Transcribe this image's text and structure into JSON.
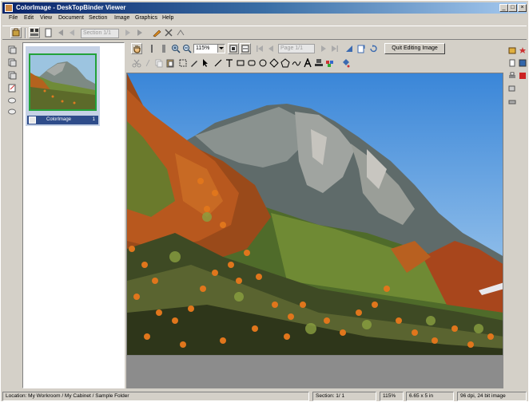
{
  "window": {
    "title": "ColorImage - DeskTopBinder Viewer",
    "buttons": {
      "minimize": "_",
      "maximize": "□",
      "close": "×"
    }
  },
  "menu": [
    "File",
    "Edit",
    "View",
    "Document",
    "Section",
    "Image",
    "Graphics",
    "Help"
  ],
  "toolbar": {
    "section_field": "Section 1/1"
  },
  "viewer_toolbar": {
    "zoom_value": "115%",
    "page_field": "Page 1/1",
    "quit_editing_label": "Quit Editing Image"
  },
  "thumbnail": {
    "name": "ColorImage",
    "count": "1"
  },
  "status": {
    "location": "Location: My Workroom / My Cabinet / Sample Folder",
    "section": "Section: 1/ 1",
    "zoom": "115%",
    "size": "6.65 x 5 in",
    "resolution": "96 dpi, 24 bit image"
  },
  "icons": {
    "app": "app-icon",
    "zoom_in": "zoom-in-icon",
    "zoom_out": "zoom-out-icon",
    "pen": "pen-icon",
    "text": "text-icon"
  },
  "colors": {
    "titlebar_start": "#0a246a",
    "titlebar_end": "#a6caf0",
    "thumbnail_border": "#22a23a",
    "thumbnail_label_bg": "#2e4c8a"
  }
}
